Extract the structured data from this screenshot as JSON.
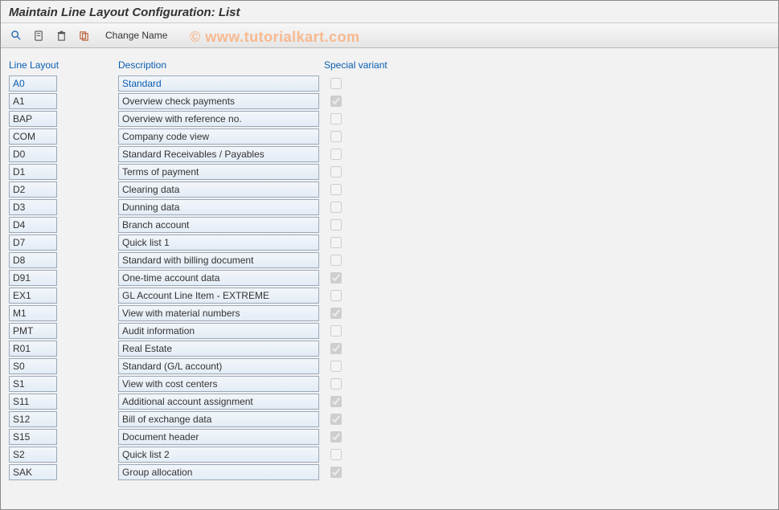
{
  "title": "Maintain Line Layout Configuration: List",
  "watermark": "© www.tutorialkart.com",
  "toolbar": {
    "changeName": "Change Name"
  },
  "headers": {
    "lineLayout": "Line Layout",
    "description": "Description",
    "special": "Special variant"
  },
  "rows": [
    {
      "code": "A0",
      "desc": "Standard",
      "special": false,
      "highlight": true
    },
    {
      "code": "A1",
      "desc": "Overview check payments",
      "special": true
    },
    {
      "code": "BAP",
      "desc": "Overview with reference no.",
      "special": false
    },
    {
      "code": "COM",
      "desc": "Company code view",
      "special": false
    },
    {
      "code": "D0",
      "desc": "Standard Receivables / Payables",
      "special": false
    },
    {
      "code": "D1",
      "desc": "Terms of payment",
      "special": false
    },
    {
      "code": "D2",
      "desc": "Clearing data",
      "special": false
    },
    {
      "code": "D3",
      "desc": "Dunning data",
      "special": false
    },
    {
      "code": "D4",
      "desc": "Branch account",
      "special": false
    },
    {
      "code": "D7",
      "desc": "Quick list 1",
      "special": false
    },
    {
      "code": "D8",
      "desc": "Standard with billing document",
      "special": false
    },
    {
      "code": "D91",
      "desc": "One-time account data",
      "special": true
    },
    {
      "code": "EX1",
      "desc": "GL Account Line Item - EXTREME",
      "special": false
    },
    {
      "code": "M1",
      "desc": "View with material numbers",
      "special": true
    },
    {
      "code": "PMT",
      "desc": "Audit information",
      "special": false
    },
    {
      "code": "R01",
      "desc": "Real Estate",
      "special": true
    },
    {
      "code": "S0",
      "desc": "Standard (G/L account)",
      "special": false
    },
    {
      "code": "S1",
      "desc": "View with cost centers",
      "special": false
    },
    {
      "code": "S11",
      "desc": "Additional account assignment",
      "special": true
    },
    {
      "code": "S12",
      "desc": "Bill of exchange data",
      "special": true
    },
    {
      "code": "S15",
      "desc": "Document header",
      "special": true
    },
    {
      "code": "S2",
      "desc": "Quick list 2",
      "special": false
    },
    {
      "code": "SAK",
      "desc": "Group allocation",
      "special": true
    }
  ]
}
